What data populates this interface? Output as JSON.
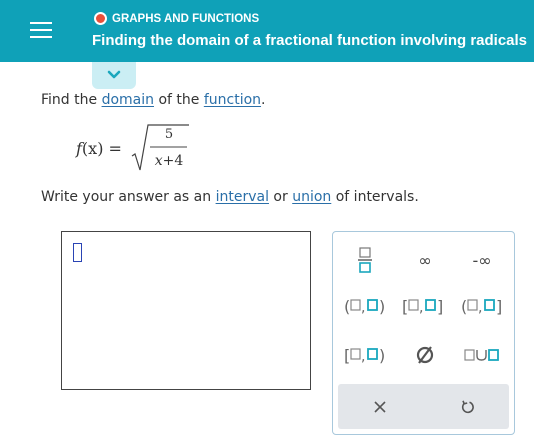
{
  "header": {
    "topic": "GRAPHS AND FUNCTIONS",
    "title": "Finding the domain of a fractional function involving radicals",
    "bg_color": "#0fa1b8",
    "status_color": "#e8503a",
    "icons": {
      "menu": "hamburger-menu-icon",
      "collapse": "chevron-down-icon"
    }
  },
  "prompt": {
    "find_the": "Find the",
    "domain_link": "domain",
    "of_the": "of the",
    "function_link": "function",
    "period": ".",
    "write_answer": "Write your answer as an",
    "interval_link": "interval",
    "or": "or",
    "union_link": "union",
    "of_intervals": "of intervals."
  },
  "formula": {
    "lhs_f": "f",
    "lhs_rest": "(x) =",
    "numerator": "5",
    "den_x": "x",
    "den_rest": "+4"
  },
  "answer": {
    "value": ""
  },
  "keypad": {
    "infinity": "∞",
    "neg_infinity": "-∞",
    "keys": [
      "fraction",
      "infinity",
      "negative-infinity",
      "open-open-interval",
      "closed-closed-interval",
      "open-closed-interval",
      "closed-open-interval",
      "empty-set",
      "union"
    ],
    "actions": [
      "clear-icon",
      "undo-icon"
    ],
    "accent_color": "#1aa7bd"
  }
}
